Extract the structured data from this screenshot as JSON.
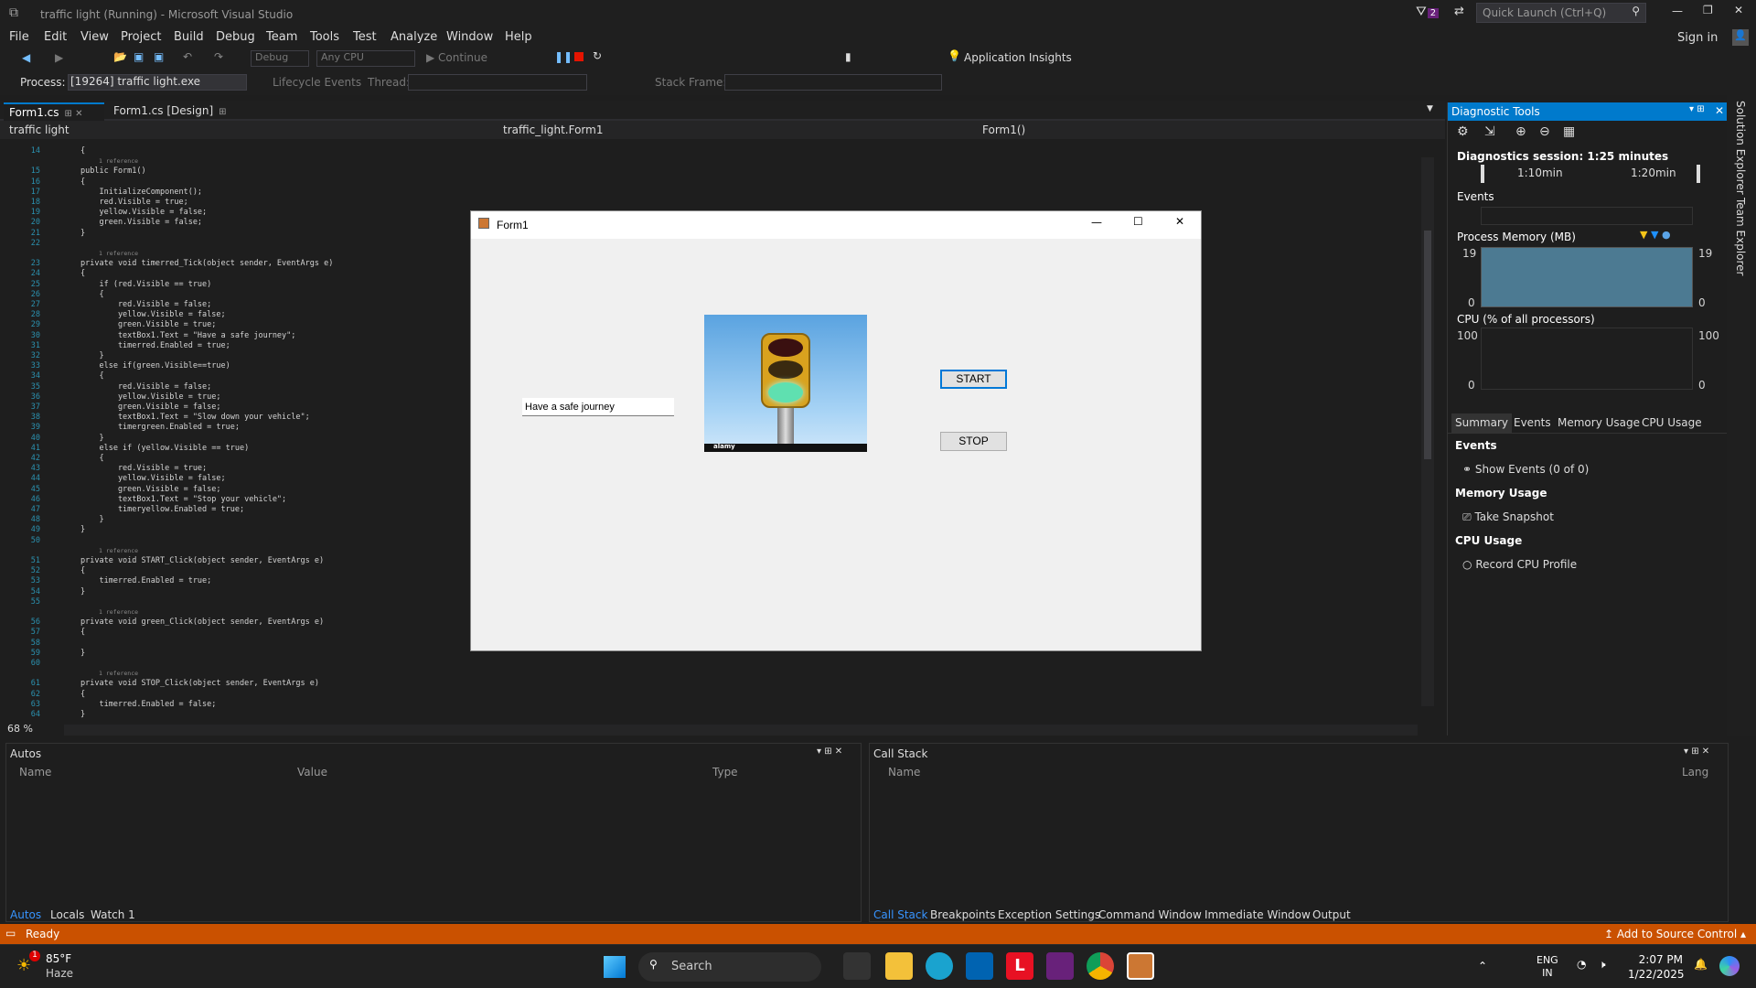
{
  "window": {
    "title": "traffic light (Running) - Microsoft Visual Studio",
    "notif_count": "2",
    "quick_launch_placeholder": "Quick Launch (Ctrl+Q)",
    "sign_in": "Sign in"
  },
  "menu": [
    "File",
    "Edit",
    "View",
    "Project",
    "Build",
    "Debug",
    "Team",
    "Tools",
    "Test",
    "Analyze",
    "Window",
    "Help"
  ],
  "toolbar": {
    "config": "Debug",
    "platform": "Any CPU",
    "continue": "Continue",
    "app_insights": "Application Insights"
  },
  "toolbar2": {
    "process_label": "Process:",
    "process_value": "[19264] traffic light.exe",
    "lifecycle": "Lifecycle Events",
    "thread_label": "Thread:",
    "stack_frame_label": "Stack Frame:"
  },
  "doc_tabs": [
    {
      "label": "Form1.cs"
    },
    {
      "label": "Form1.cs [Design]"
    }
  ],
  "nav": {
    "project": "traffic light",
    "class": "traffic_light.Form1",
    "member": "Form1()"
  },
  "code_lines": [
    {
      "n": "14",
      "t": "{"
    },
    {
      "n": "",
      "t": "1 reference",
      "r": true
    },
    {
      "n": "15",
      "t": "public Form1()"
    },
    {
      "n": "16",
      "t": "{"
    },
    {
      "n": "17",
      "t": "    InitializeComponent();"
    },
    {
      "n": "18",
      "t": "    red.Visible = true;"
    },
    {
      "n": "19",
      "t": "    yellow.Visible = false;"
    },
    {
      "n": "20",
      "t": "    green.Visible = false;"
    },
    {
      "n": "21",
      "t": "}"
    },
    {
      "n": "22",
      "t": ""
    },
    {
      "n": "",
      "t": "1 reference",
      "r": true
    },
    {
      "n": "23",
      "t": "private void timerred_Tick(object sender, EventArgs e)"
    },
    {
      "n": "24",
      "t": "{"
    },
    {
      "n": "25",
      "t": "    if (red.Visible == true)"
    },
    {
      "n": "26",
      "t": "    {"
    },
    {
      "n": "27",
      "t": "        red.Visible = false;"
    },
    {
      "n": "28",
      "t": "        yellow.Visible = false;"
    },
    {
      "n": "29",
      "t": "        green.Visible = true;"
    },
    {
      "n": "30",
      "t": "        textBox1.Text = \"Have a safe journey\";"
    },
    {
      "n": "31",
      "t": "        timerred.Enabled = true;"
    },
    {
      "n": "32",
      "t": "    }"
    },
    {
      "n": "33",
      "t": "    else if(green.Visible==true)"
    },
    {
      "n": "34",
      "t": "    {"
    },
    {
      "n": "35",
      "t": "        red.Visible = false;"
    },
    {
      "n": "36",
      "t": "        yellow.Visible = true;"
    },
    {
      "n": "37",
      "t": "        green.Visible = false;"
    },
    {
      "n": "38",
      "t": "        textBox1.Text = \"Slow down your vehicle\";"
    },
    {
      "n": "39",
      "t": "        timergreen.Enabled = true;"
    },
    {
      "n": "40",
      "t": "    }"
    },
    {
      "n": "41",
      "t": "    else if (yellow.Visible == true)"
    },
    {
      "n": "42",
      "t": "    {"
    },
    {
      "n": "43",
      "t": "        red.Visible = true;"
    },
    {
      "n": "44",
      "t": "        yellow.Visible = false;"
    },
    {
      "n": "45",
      "t": "        green.Visible = false;"
    },
    {
      "n": "46",
      "t": "        textBox1.Text = \"Stop your vehicle\";"
    },
    {
      "n": "47",
      "t": "        timeryellow.Enabled = true;"
    },
    {
      "n": "48",
      "t": "    }"
    },
    {
      "n": "49",
      "t": "}"
    },
    {
      "n": "50",
      "t": ""
    },
    {
      "n": "",
      "t": "1 reference",
      "r": true
    },
    {
      "n": "51",
      "t": "private void START_Click(object sender, EventArgs e)"
    },
    {
      "n": "52",
      "t": "{"
    },
    {
      "n": "53",
      "t": "    timerred.Enabled = true;"
    },
    {
      "n": "54",
      "t": "}"
    },
    {
      "n": "55",
      "t": ""
    },
    {
      "n": "",
      "t": "1 reference",
      "r": true
    },
    {
      "n": "56",
      "t": "private void green_Click(object sender, EventArgs e)"
    },
    {
      "n": "57",
      "t": "{"
    },
    {
      "n": "58",
      "t": ""
    },
    {
      "n": "59",
      "t": "}"
    },
    {
      "n": "60",
      "t": ""
    },
    {
      "n": "",
      "t": "1 reference",
      "r": true
    },
    {
      "n": "61",
      "t": "private void STOP_Click(object sender, EventArgs e)"
    },
    {
      "n": "62",
      "t": "{"
    },
    {
      "n": "63",
      "t": "    timerred.Enabled = false;"
    },
    {
      "n": "64",
      "t": "}"
    }
  ],
  "zoom": "68 %",
  "form1": {
    "title": "Form1",
    "textbox": "Have a safe journey",
    "start": "START",
    "stop": "STOP",
    "img_watermark": "alamy"
  },
  "diagnostics": {
    "title": "Diagnostic Tools",
    "session": "Diagnostics session: 1:25 minutes",
    "tick1": "1:10min",
    "tick2": "1:20min",
    "events_label": "Events",
    "memory_label": "Process Memory (MB)",
    "mem_max": "19",
    "mem_min": "0",
    "cpu_label": "CPU (% of all processors)",
    "cpu_max": "100",
    "cpu_min": "0",
    "tabs": [
      "Summary",
      "Events",
      "Memory Usage",
      "CPU Usage"
    ],
    "sec_events": "Events",
    "show_events": "Show Events (0 of 0)",
    "sec_memory": "Memory Usage",
    "take_snapshot": "Take Snapshot",
    "sec_cpu": "CPU Usage",
    "record_cpu": "Record CPU Profile"
  },
  "right_strip": [
    "Solution Explorer",
    "Team Explorer"
  ],
  "autos": {
    "title": "Autos",
    "cols": [
      "Name",
      "Value",
      "Type"
    ],
    "tabs": [
      "Autos",
      "Locals",
      "Watch 1"
    ]
  },
  "callstack": {
    "title": "Call Stack",
    "cols": [
      "Name",
      "Lang"
    ],
    "tabs": [
      "Call Stack",
      "Breakpoints",
      "Exception Settings",
      "Command Window",
      "Immediate Window",
      "Output"
    ]
  },
  "status": {
    "ready": "Ready",
    "source_control": "Add to Source Control"
  },
  "taskbar": {
    "temp": "85°F",
    "weather": "Haze",
    "weather_badge": "1",
    "search": "Search",
    "lang1": "ENG",
    "lang2": "IN",
    "time": "2:07 PM",
    "date": "1/22/2025"
  },
  "colors": {
    "accent": "#007acc",
    "status": "#ca5100"
  }
}
